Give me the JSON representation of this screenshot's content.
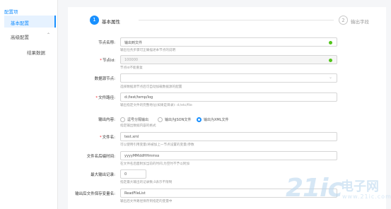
{
  "sidebar": {
    "title": "配置项",
    "items": [
      {
        "label": "基本配置"
      },
      {
        "label": "高级配置"
      },
      {
        "label": "结果数据"
      }
    ]
  },
  "steps": [
    {
      "number": "1",
      "label": "基本属性"
    },
    {
      "number": "2",
      "label": "输出字段"
    }
  ],
  "form": {
    "node_name": {
      "label": "节点名称:",
      "value": "输出到文件",
      "hint": "输出任务步骤可正确描述本节点的说明"
    },
    "node_id": {
      "label": "节点Id:",
      "value": "100000",
      "hint": "节点Id不能重复"
    },
    "data_source": {
      "label": "数据源节点:",
      "value": "",
      "hint": "选择数据源节点后可自动加载数据源的配置"
    },
    "file_path": {
      "label": "文件路径:",
      "value": "d:/test/temp/log",
      "hint": "输出指定文件的完整地址(如果是目录): d:/etc/file"
    },
    "output_format": {
      "label": "输出内容:",
      "options": [
        "逗号分隔输出",
        "输出为JSON文件",
        "输出为XML文件"
      ],
      "selected": "输出为XML文件",
      "hint": "指定输出数据内容的格式"
    },
    "file_name": {
      "label": "文件名:",
      "value": "test.xml",
      "hint": "可以使用引用变量(将被加上一节点设置的变量)参数"
    },
    "date_format": {
      "label": "文件名后缀时间:",
      "value": "yyyyMMddHHmmss",
      "hint": "在文件名后面附加当前的时间,为空时不予以附加"
    },
    "max_records": {
      "label": "最大输出记录:",
      "value": "0",
      "hint": "指定最大输出的记录数,0表示不限制"
    },
    "var_name": {
      "label": "输出后文件保存变量名:",
      "value": "ReadFileList",
      "hint": "输出后文件路径保存到指定的变量中"
    }
  },
  "watermark": {
    "big": "21ic",
    "cn": "电子网",
    "url": "www.21ic.com"
  }
}
